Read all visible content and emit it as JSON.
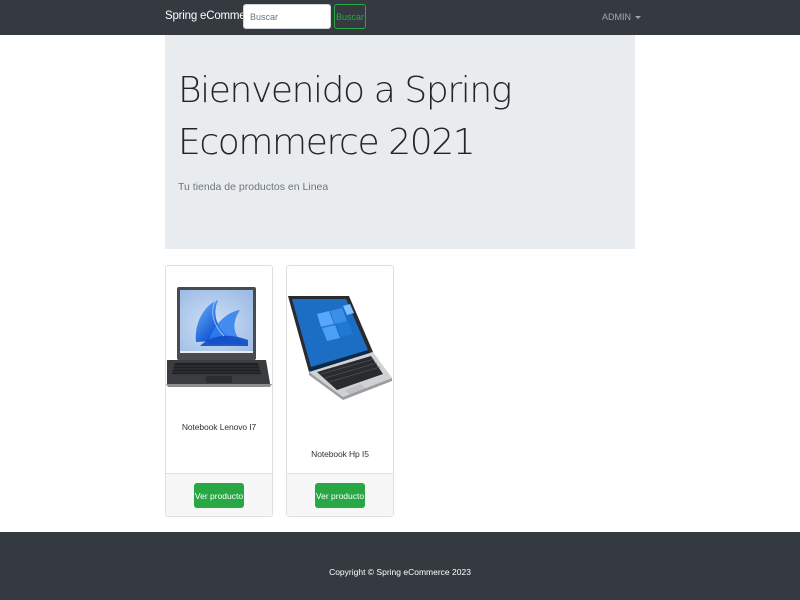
{
  "navbar": {
    "brand": "Spring eCommerce",
    "search_placeholder": "Buscar",
    "search_button": "Buscar",
    "admin_menu": "ADMIN"
  },
  "hero": {
    "title": "Bienvenido a Spring Ecommerce 2021",
    "subtitle": "Tu tienda de productos en Linea"
  },
  "products": [
    {
      "name": "Notebook Lenovo I7",
      "button": "Ver producto",
      "image": "laptop-lenovo-image"
    },
    {
      "name": "Notebook Hp I5",
      "button": "Ver producto",
      "image": "laptop-hp-image"
    }
  ],
  "footer": {
    "copyright": "Copyright © Spring eCommerce 2023"
  },
  "colors": {
    "navbar": "#343a40",
    "jumbotron": "#e9ecef",
    "success": "#28a745"
  }
}
